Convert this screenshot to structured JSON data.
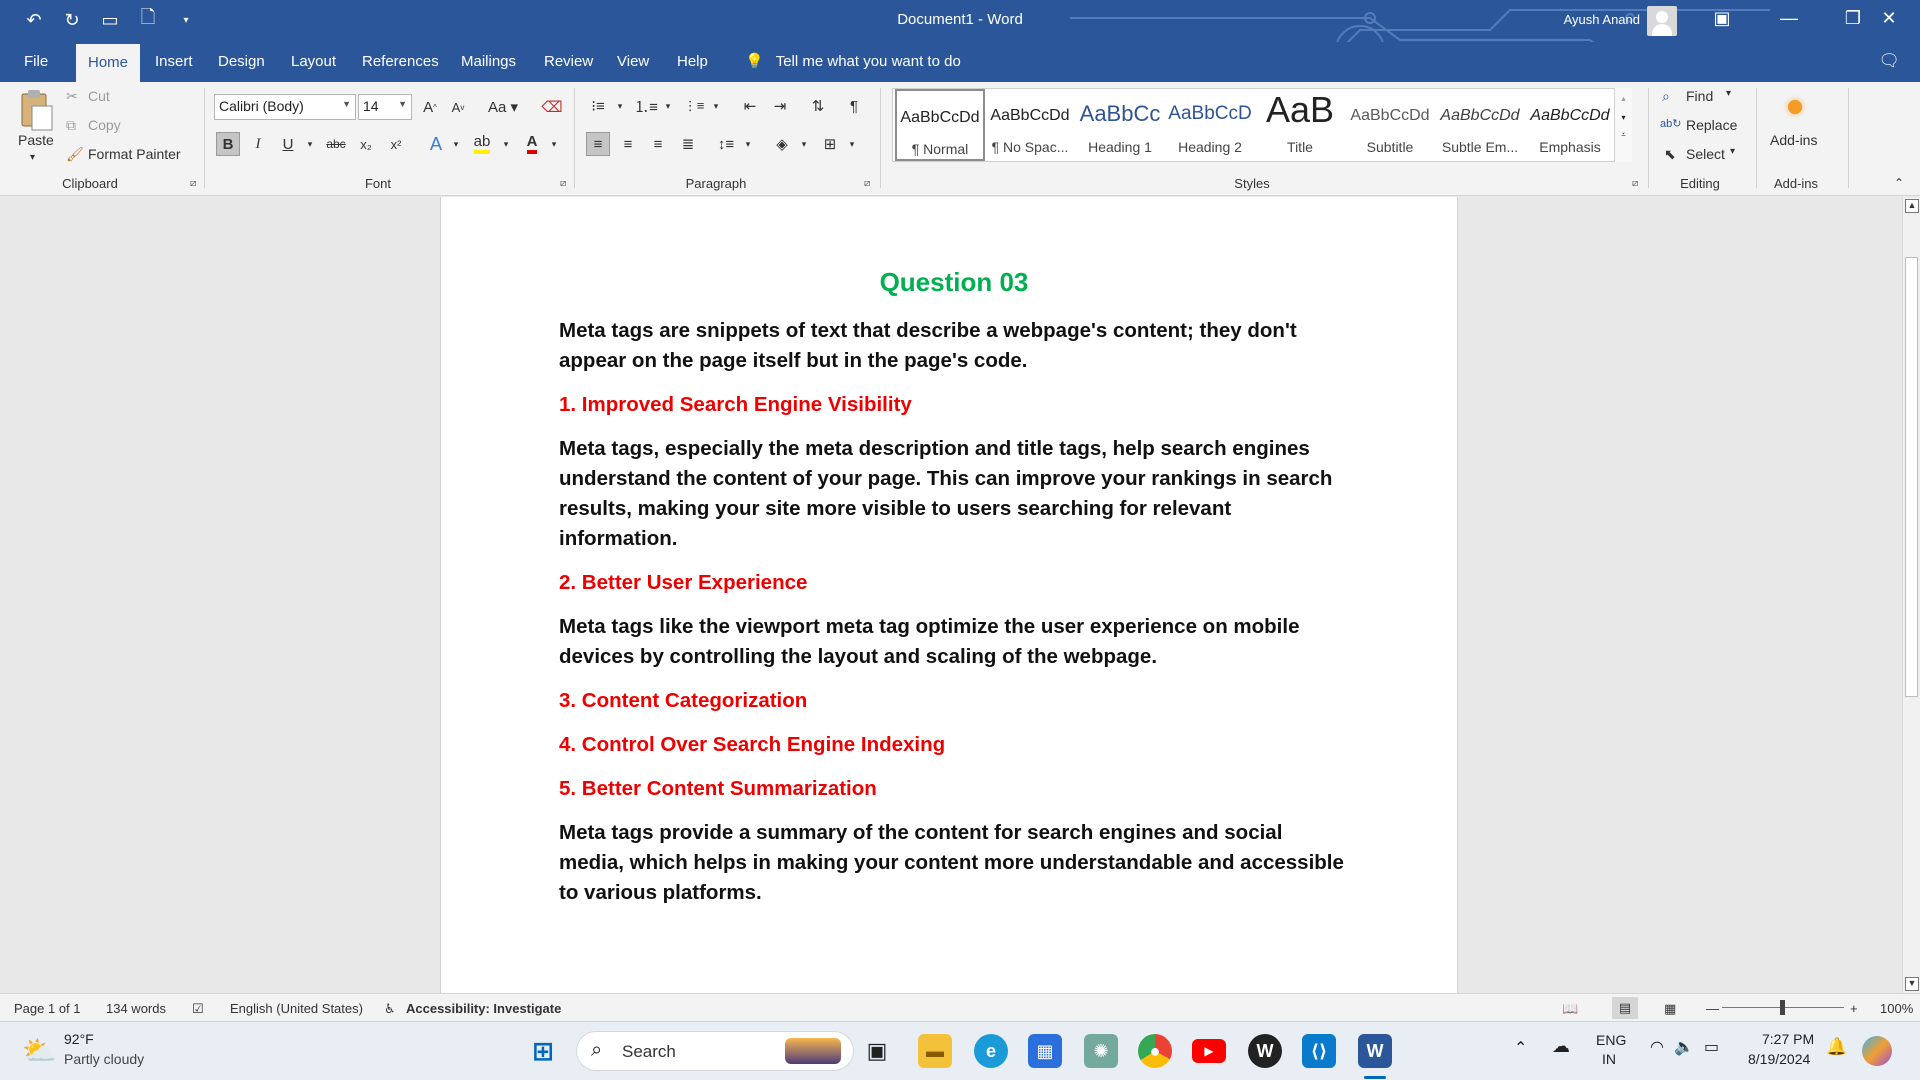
{
  "window": {
    "title": "Document1 - Word",
    "user": "Ayush Anand"
  },
  "tabs": [
    "File",
    "Home",
    "Insert",
    "Design",
    "Layout",
    "References",
    "Mailings",
    "Review",
    "View",
    "Help"
  ],
  "tell_me": "Tell me what you want to do",
  "clipboard": {
    "paste": "Paste",
    "cut": "Cut",
    "copy": "Copy",
    "format_painter": "Format Painter",
    "label": "Clipboard"
  },
  "font": {
    "name": "Calibri (Body)",
    "size": "14",
    "label": "Font"
  },
  "paragraph": {
    "label": "Paragraph"
  },
  "styles": {
    "label": "Styles",
    "items": [
      {
        "preview": "AaBbCcDd",
        "name": "¶ Normal"
      },
      {
        "preview": "AaBbCcDd",
        "name": "¶ No Spac..."
      },
      {
        "preview": "AaBbCc",
        "name": "Heading 1"
      },
      {
        "preview": "AaBbCcD",
        "name": "Heading 2"
      },
      {
        "preview": "AaB",
        "name": "Title"
      },
      {
        "preview": "AaBbCcDd",
        "name": "Subtitle"
      },
      {
        "preview": "AaBbCcDd",
        "name": "Subtle Em..."
      },
      {
        "preview": "AaBbCcDd",
        "name": "Emphasis"
      }
    ]
  },
  "editing": {
    "find": "Find",
    "replace": "Replace",
    "select": "Select",
    "label": "Editing"
  },
  "addins": {
    "button": "Add-ins",
    "label": "Add-ins"
  },
  "document": {
    "title": "Question 03",
    "intro": "Meta tags are snippets of text that describe a webpage's content; they don't appear on the page itself but in the page's code.",
    "h1": "1. Improved Search Engine Visibility",
    "p1": "Meta tags, especially the meta description and title tags, help search engines understand the content of your page. This can improve your rankings in search results, making your site more visible to users searching for relevant information.",
    "h2": "2. Better User Experience",
    "p2": "Meta tags like the viewport meta tag optimize the user experience on mobile devices by controlling the layout and scaling of the webpage.",
    "h3": "3. Content Categorization",
    "h4": "4. Control Over Search Engine Indexing",
    "h5": "5. Better Content Summarization",
    "p5": "Meta tags provide a summary of the content for search engines and social media, which helps in making your content more understandable and accessible to various platforms."
  },
  "status": {
    "page": "Page 1 of 1",
    "words": "134 words",
    "language": "English (United States)",
    "accessibility": "Accessibility: Investigate",
    "zoom": "100%"
  },
  "taskbar": {
    "weather_temp": "92°F",
    "weather_desc": "Partly cloudy",
    "search": "Search",
    "lang_top": "ENG",
    "lang_bottom": "IN",
    "time": "7:27 PM",
    "date": "8/19/2024"
  }
}
